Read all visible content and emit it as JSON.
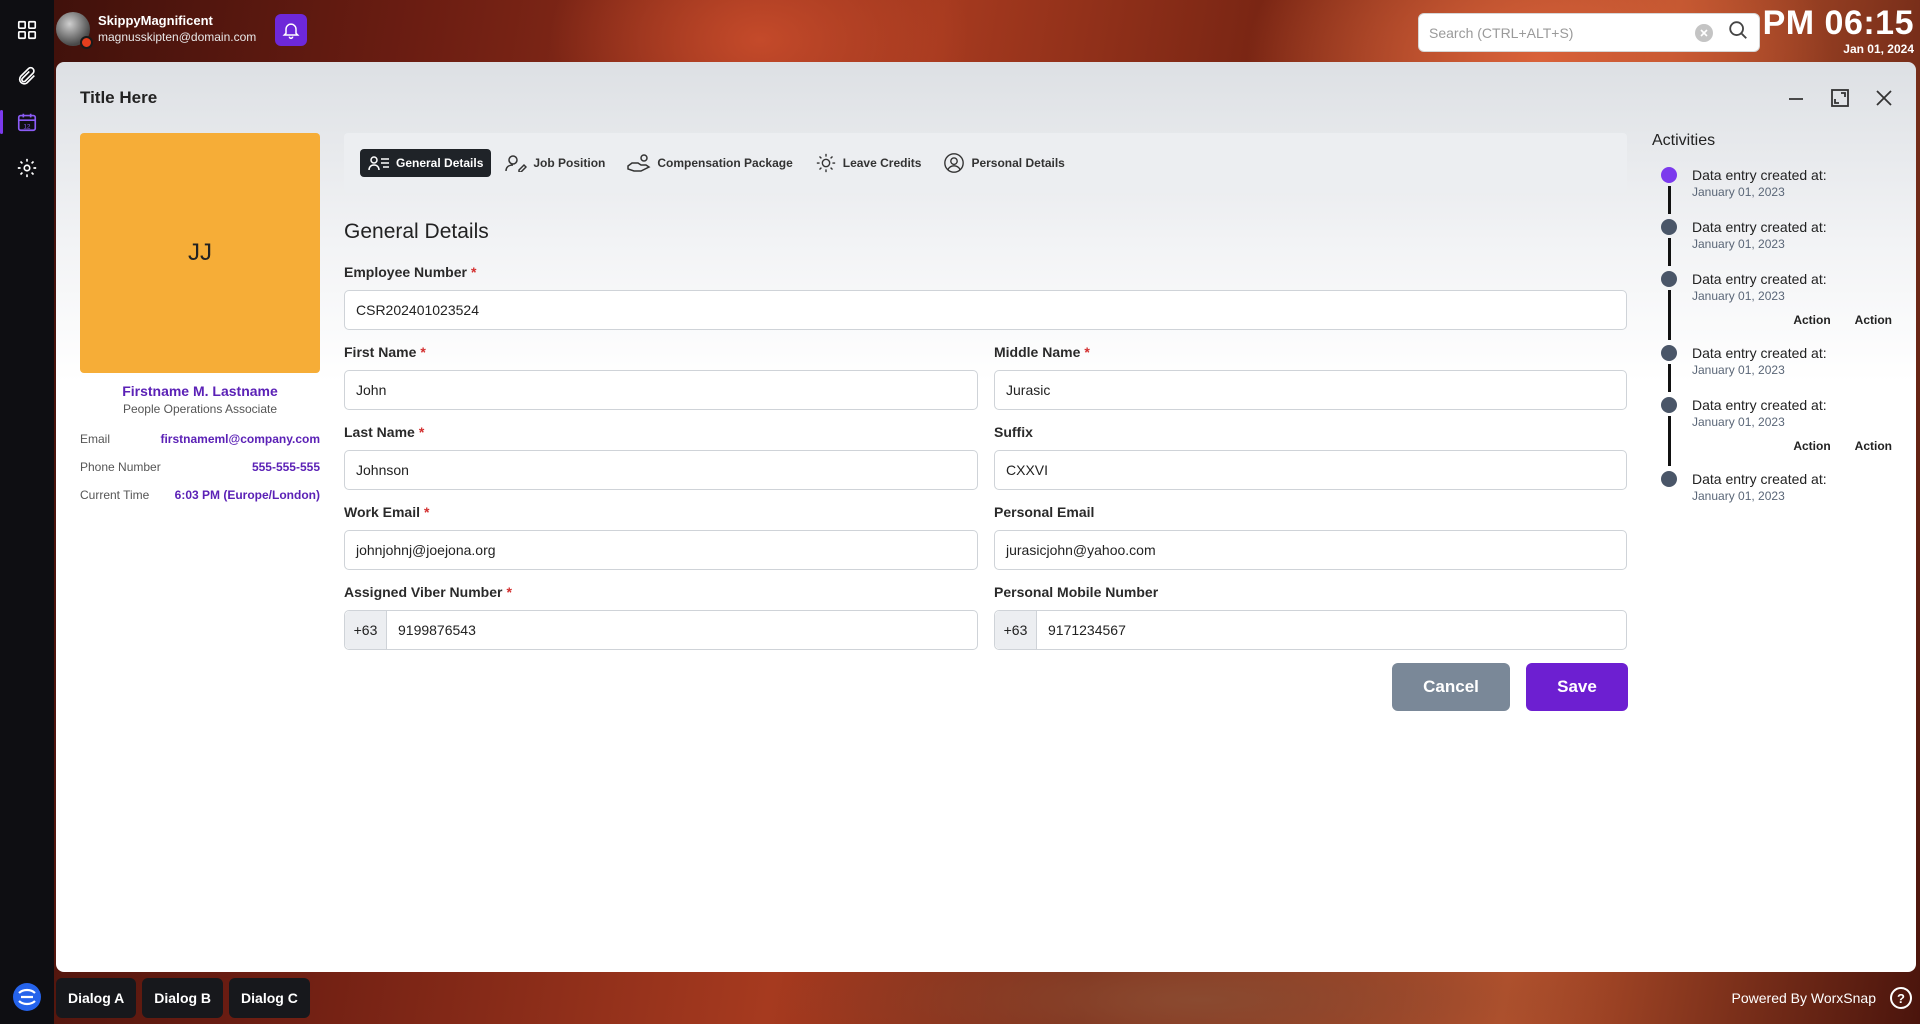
{
  "user": {
    "name": "SkippyMagnificent",
    "email": "magnusskipten@domain.com"
  },
  "search": {
    "placeholder": "Search (CTRL+ALT+S)"
  },
  "clock": {
    "time": "PM 06:15",
    "date": "Jan 01, 2024"
  },
  "window": {
    "title": "Title Here"
  },
  "profile": {
    "initials": "JJ",
    "name": "Firstname M. Lastname",
    "role": "People Operations Associate",
    "rows": [
      {
        "label": "Email",
        "value": "firstnameml@company.com"
      },
      {
        "label": "Phone Number",
        "value": "555-555-555"
      },
      {
        "label": "Current Time",
        "value": "6:03 PM (Europe/London)"
      }
    ]
  },
  "tabs": [
    {
      "label": "General Details",
      "icon": "id-list-icon",
      "active": true
    },
    {
      "label": "Job Position",
      "icon": "user-pen-icon",
      "active": false
    },
    {
      "label": "Compensation Package",
      "icon": "hand-coins-icon",
      "active": false
    },
    {
      "label": "Leave Credits",
      "icon": "sun-icon",
      "active": false
    },
    {
      "label": "Personal Details",
      "icon": "user-circle-icon",
      "active": false
    }
  ],
  "form": {
    "title": "General Details",
    "employee_number": {
      "label": "Employee Number",
      "value": "CSR202401023524"
    },
    "first_name": {
      "label": "First Name",
      "value": "John"
    },
    "middle_name": {
      "label": "Middle Name",
      "value": "Jurasic"
    },
    "last_name": {
      "label": "Last Name",
      "value": "Johnson"
    },
    "suffix": {
      "label": "Suffix",
      "value": "CXXVI"
    },
    "work_email": {
      "label": "Work Email",
      "value": "johnjohnj@joejona.org"
    },
    "personal_email": {
      "label": "Personal Email",
      "value": "jurasicjohn@yahoo.com"
    },
    "viber": {
      "label": "Assigned Viber Number",
      "code": "+63",
      "value": "9199876543"
    },
    "mobile": {
      "label": "Personal Mobile Number",
      "code": "+63",
      "value": "9171234567"
    },
    "required_mark": "*",
    "cancel_label": "Cancel",
    "save_label": "Save"
  },
  "activities": {
    "title": "Activities",
    "items": [
      {
        "text": "Data entry created at:",
        "date": "January 01, 2023"
      },
      {
        "text": "Data entry created at:",
        "date": "January 01, 2023"
      },
      {
        "text": "Data entry created at:",
        "date": "January 01, 2023",
        "actions": [
          "Action",
          "Action"
        ]
      },
      {
        "text": "Data entry created at:",
        "date": "January 01, 2023"
      },
      {
        "text": "Data entry created at:",
        "date": "January 01, 2023",
        "actions": [
          "Action",
          "Action"
        ]
      },
      {
        "text": "Data entry created at:",
        "date": "January 01, 2023"
      }
    ]
  },
  "taskbar": {
    "items": [
      "Dialog A",
      "Dialog B",
      "Dialog C"
    ]
  },
  "footer": {
    "powered": "Powered By WorxSnap"
  },
  "colors": {
    "accent": "#6d1fd1",
    "profile_bg": "#f6ad37",
    "required": "#d32f2f"
  }
}
